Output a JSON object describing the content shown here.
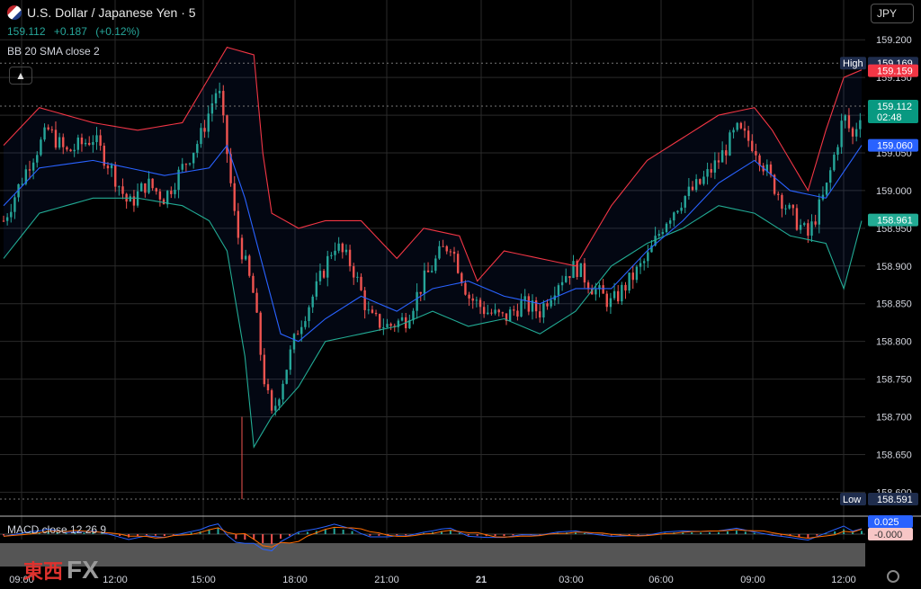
{
  "header": {
    "title": "U.S. Dollar / Japanese Yen · 5",
    "last": "159.112",
    "change": "+0.187",
    "change_pct": "(+0.12%)",
    "indicator": "BB 20 SMA close 2",
    "currency_button": "JPY",
    "macd_label": "MACD close 12 26 9"
  },
  "watermark": {
    "jp": "東西",
    "fx": "FX"
  },
  "price_tags": [
    {
      "label": "High",
      "value": "159.169",
      "color": "#1f2d4d",
      "price": 159.169
    },
    {
      "label": "",
      "value": "159.159",
      "color": "#f23645",
      "price": 159.159
    },
    {
      "label": "",
      "value": "159.112",
      "sub": "02:48",
      "color": "#089981",
      "price": 159.112
    },
    {
      "label": "",
      "value": "159.060",
      "color": "#2962ff",
      "price": 159.06
    },
    {
      "label": "",
      "value": "158.961",
      "color": "#22ab94",
      "price": 158.961
    },
    {
      "label": "Low",
      "value": "158.591",
      "color": "#1f2d4d",
      "price": 158.591
    }
  ],
  "macd_tags": [
    {
      "value": "0.025",
      "color": "#2962ff"
    },
    {
      "value": "-0.000",
      "color": "#f7c6c6",
      "text_color": "#333"
    }
  ],
  "colors": {
    "up": "#26a69a",
    "down": "#ef5350",
    "bb_basis": "#2962ff",
    "bb_upper": "#f23645",
    "bb_lower": "#22ab94",
    "macd": "#2962ff",
    "signal": "#ff6d00"
  },
  "chart_data": {
    "type": "candlestick",
    "symbol": "U.S. Dollar / Japanese Yen",
    "interval": "5",
    "y_ticks": [
      "159.200",
      "159.150",
      "159.100",
      "159.050",
      "159.000",
      "158.950",
      "158.900",
      "158.850",
      "158.800",
      "158.750",
      "158.700",
      "158.650",
      "158.600"
    ],
    "ylim": [
      158.585,
      159.205
    ],
    "x_ticks": [
      "09:00",
      "12:00",
      "15:00",
      "18:00",
      "21:00",
      "21",
      "03:00",
      "06:00",
      "09:00",
      "12:00"
    ],
    "price_path": [
      [
        0,
        158.96
      ],
      [
        3,
        159.04
      ],
      [
        5,
        159.08
      ],
      [
        7,
        159.05
      ],
      [
        10,
        159.07
      ],
      [
        12,
        159.03
      ],
      [
        14,
        158.98
      ],
      [
        16,
        159.01
      ],
      [
        18,
        158.99
      ],
      [
        20,
        159.03
      ],
      [
        22,
        159.07
      ],
      [
        24,
        159.14
      ],
      [
        25,
        159.05
      ],
      [
        26,
        158.95
      ],
      [
        28,
        158.86
      ],
      [
        29,
        158.76
      ],
      [
        30,
        158.7
      ],
      [
        31,
        158.74
      ],
      [
        33,
        158.82
      ],
      [
        35,
        158.87
      ],
      [
        37,
        158.93
      ],
      [
        39,
        158.9
      ],
      [
        41,
        158.83
      ],
      [
        43,
        158.82
      ],
      [
        45,
        158.83
      ],
      [
        47,
        158.88
      ],
      [
        49,
        158.92
      ],
      [
        50,
        158.93
      ],
      [
        52,
        158.86
      ],
      [
        54,
        158.84
      ],
      [
        56,
        158.83
      ],
      [
        58,
        158.85
      ],
      [
        60,
        158.84
      ],
      [
        62,
        158.88
      ],
      [
        64,
        158.9
      ],
      [
        66,
        158.87
      ],
      [
        68,
        158.85
      ],
      [
        70,
        158.88
      ],
      [
        72,
        158.91
      ],
      [
        74,
        158.96
      ],
      [
        76,
        158.99
      ],
      [
        78,
        159.01
      ],
      [
        80,
        159.04
      ],
      [
        82,
        159.08
      ],
      [
        84,
        159.06
      ],
      [
        86,
        159.01
      ],
      [
        88,
        158.97
      ],
      [
        90,
        158.94
      ],
      [
        92,
        159.0
      ],
      [
        94,
        159.1
      ],
      [
        95,
        159.07
      ],
      [
        96,
        159.11
      ]
    ],
    "series": [
      {
        "name": "BB 20 SMA close 2",
        "basis": [
          [
            0,
            158.98
          ],
          [
            4,
            159.03
          ],
          [
            10,
            159.04
          ],
          [
            18,
            159.02
          ],
          [
            23,
            159.03
          ],
          [
            25,
            159.06
          ],
          [
            27,
            158.99
          ],
          [
            29,
            158.9
          ],
          [
            31,
            158.81
          ],
          [
            33,
            158.8
          ],
          [
            36,
            158.83
          ],
          [
            40,
            158.86
          ],
          [
            44,
            158.84
          ],
          [
            48,
            158.87
          ],
          [
            52,
            158.88
          ],
          [
            56,
            158.86
          ],
          [
            60,
            158.85
          ],
          [
            64,
            158.87
          ],
          [
            68,
            158.87
          ],
          [
            72,
            158.92
          ],
          [
            76,
            158.96
          ],
          [
            80,
            159.01
          ],
          [
            84,
            159.04
          ],
          [
            88,
            159.0
          ],
          [
            92,
            158.99
          ],
          [
            96,
            159.06
          ]
        ],
        "upper": [
          [
            0,
            159.06
          ],
          [
            4,
            159.11
          ],
          [
            10,
            159.09
          ],
          [
            15,
            159.08
          ],
          [
            20,
            159.09
          ],
          [
            25,
            159.19
          ],
          [
            28,
            159.18
          ],
          [
            29,
            159.05
          ],
          [
            30,
            158.97
          ],
          [
            33,
            158.95
          ],
          [
            36,
            158.96
          ],
          [
            40,
            158.96
          ],
          [
            44,
            158.91
          ],
          [
            47,
            158.95
          ],
          [
            51,
            158.94
          ],
          [
            53,
            158.88
          ],
          [
            56,
            158.92
          ],
          [
            60,
            158.91
          ],
          [
            64,
            158.9
          ],
          [
            68,
            158.98
          ],
          [
            72,
            159.04
          ],
          [
            76,
            159.07
          ],
          [
            80,
            159.1
          ],
          [
            84,
            159.11
          ],
          [
            86,
            159.08
          ],
          [
            90,
            159.0
          ],
          [
            92,
            159.08
          ],
          [
            94,
            159.15
          ],
          [
            96,
            159.16
          ]
        ],
        "lower": [
          [
            0,
            158.91
          ],
          [
            4,
            158.97
          ],
          [
            10,
            158.99
          ],
          [
            15,
            158.99
          ],
          [
            20,
            158.98
          ],
          [
            23,
            158.96
          ],
          [
            25,
            158.92
          ],
          [
            27,
            158.78
          ],
          [
            28,
            158.66
          ],
          [
            30,
            158.7
          ],
          [
            33,
            158.74
          ],
          [
            36,
            158.8
          ],
          [
            40,
            158.81
          ],
          [
            44,
            158.82
          ],
          [
            48,
            158.84
          ],
          [
            52,
            158.82
          ],
          [
            56,
            158.83
          ],
          [
            60,
            158.81
          ],
          [
            64,
            158.84
          ],
          [
            68,
            158.9
          ],
          [
            72,
            158.93
          ],
          [
            76,
            158.95
          ],
          [
            80,
            158.98
          ],
          [
            84,
            158.97
          ],
          [
            88,
            158.94
          ],
          [
            92,
            158.93
          ],
          [
            94,
            158.87
          ],
          [
            96,
            158.96
          ]
        ]
      },
      {
        "name": "MACD close 12 26 9",
        "macd": 0.025,
        "signal": -0.0
      }
    ]
  }
}
